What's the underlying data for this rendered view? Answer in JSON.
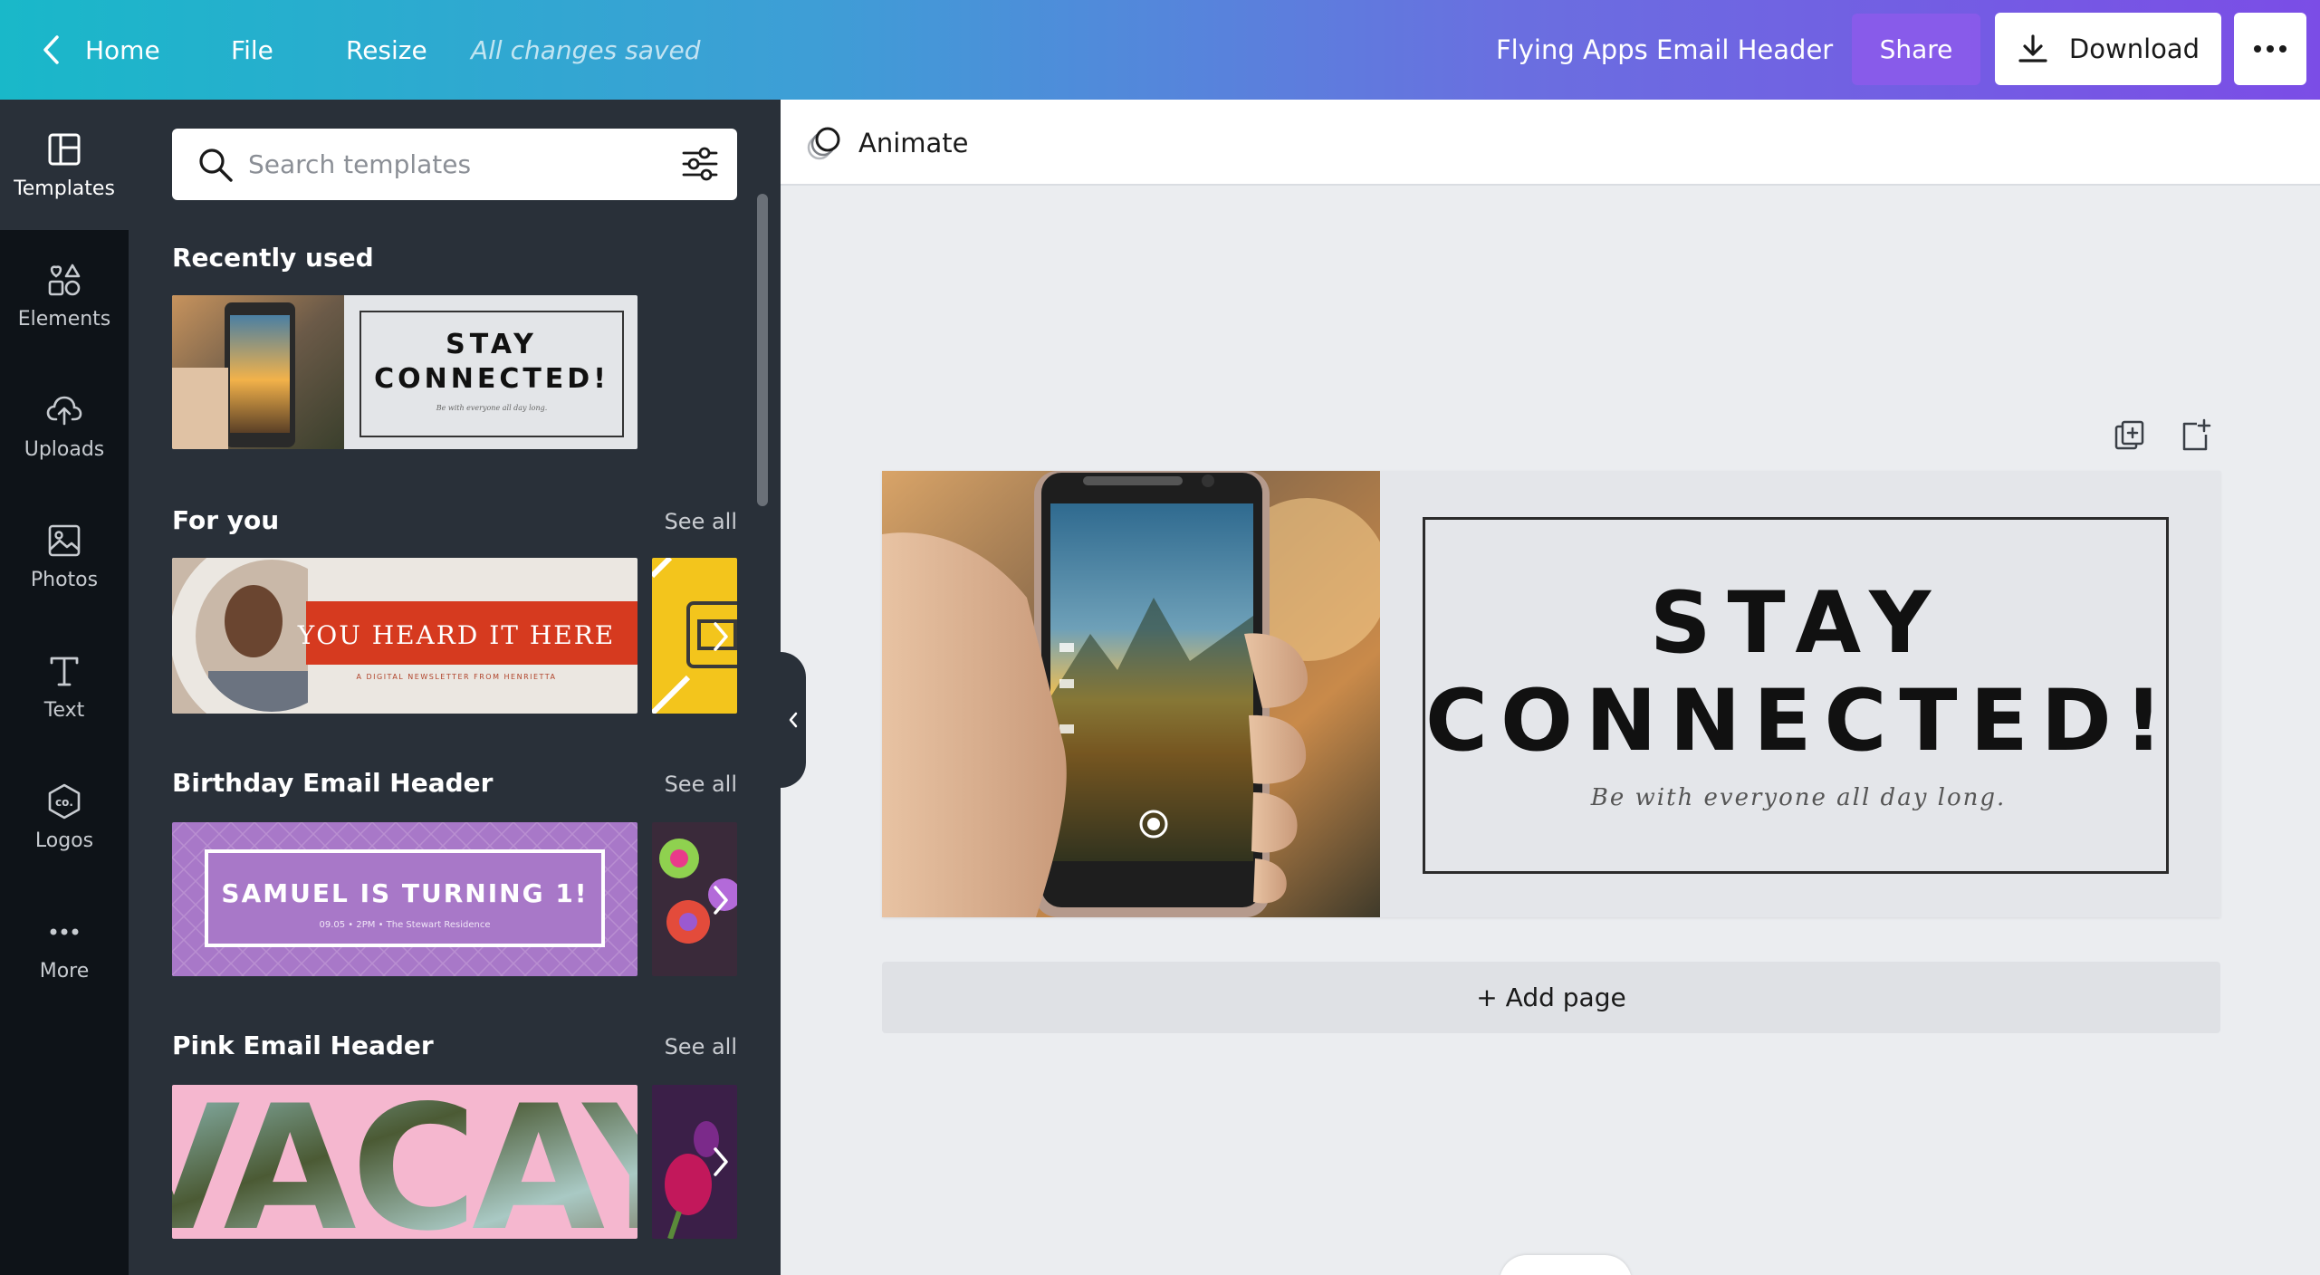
{
  "topbar": {
    "home": "Home",
    "file": "File",
    "resize": "Resize",
    "saved_status": "All changes saved",
    "design_title": "Flying Apps Email Header",
    "share": "Share",
    "download": "Download"
  },
  "rail": {
    "templates": "Templates",
    "elements": "Elements",
    "uploads": "Uploads",
    "photos": "Photos",
    "text": "Text",
    "logos": "Logos",
    "more": "More"
  },
  "panel": {
    "search_placeholder": "Search templates",
    "recently_used": "Recently used",
    "for_you": "For you",
    "birthday": "Birthday Email Header",
    "pink": "Pink Email Header",
    "see_all": "See all",
    "thumbs": {
      "recent_line1": "STAY",
      "recent_line2": "CONNECTED!",
      "recent_sub": "Be with everyone all day long.",
      "foryou_title": "YOU HEARD IT HERE",
      "foryou_sub": "A DIGITAL NEWSLETTER FROM HENRIETTA",
      "birthday_title": "SAMUEL IS TURNING 1!",
      "birthday_sub": "09.05 • 2PM • The Stewart Residence",
      "pink_word": "VACAY"
    }
  },
  "canvas": {
    "animate": "Animate",
    "headline_1": "STAY",
    "headline_2": "CONNECTED!",
    "tagline": "Be with everyone all day long.",
    "add_page": "+ Add page"
  },
  "colors": {
    "accent_purple": "#7b4de6",
    "accent_teal": "#19b8c9",
    "panel_bg": "#293039",
    "rail_bg": "#0e1318"
  }
}
